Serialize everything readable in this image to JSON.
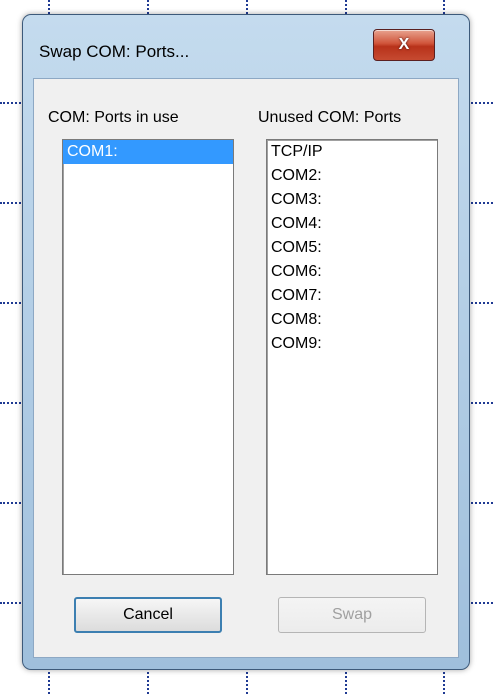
{
  "dialog": {
    "title": "Swap COM: Ports...",
    "close_glyph": "X",
    "close_icon": "close-icon"
  },
  "used_ports": {
    "label": "COM: Ports in use",
    "items": [
      {
        "label": "COM1:",
        "selected": true
      }
    ]
  },
  "unused_ports": {
    "label": "Unused COM: Ports",
    "items": [
      {
        "label": "TCP/IP"
      },
      {
        "label": "COM2:"
      },
      {
        "label": "COM3:"
      },
      {
        "label": "COM4:"
      },
      {
        "label": "COM5:"
      },
      {
        "label": "COM6:"
      },
      {
        "label": "COM7:"
      },
      {
        "label": "COM8:"
      },
      {
        "label": "COM9:"
      }
    ]
  },
  "buttons": {
    "cancel": "Cancel",
    "swap": "Swap"
  },
  "colors": {
    "selection": "#3399ff",
    "grid": "#1f3a93"
  }
}
